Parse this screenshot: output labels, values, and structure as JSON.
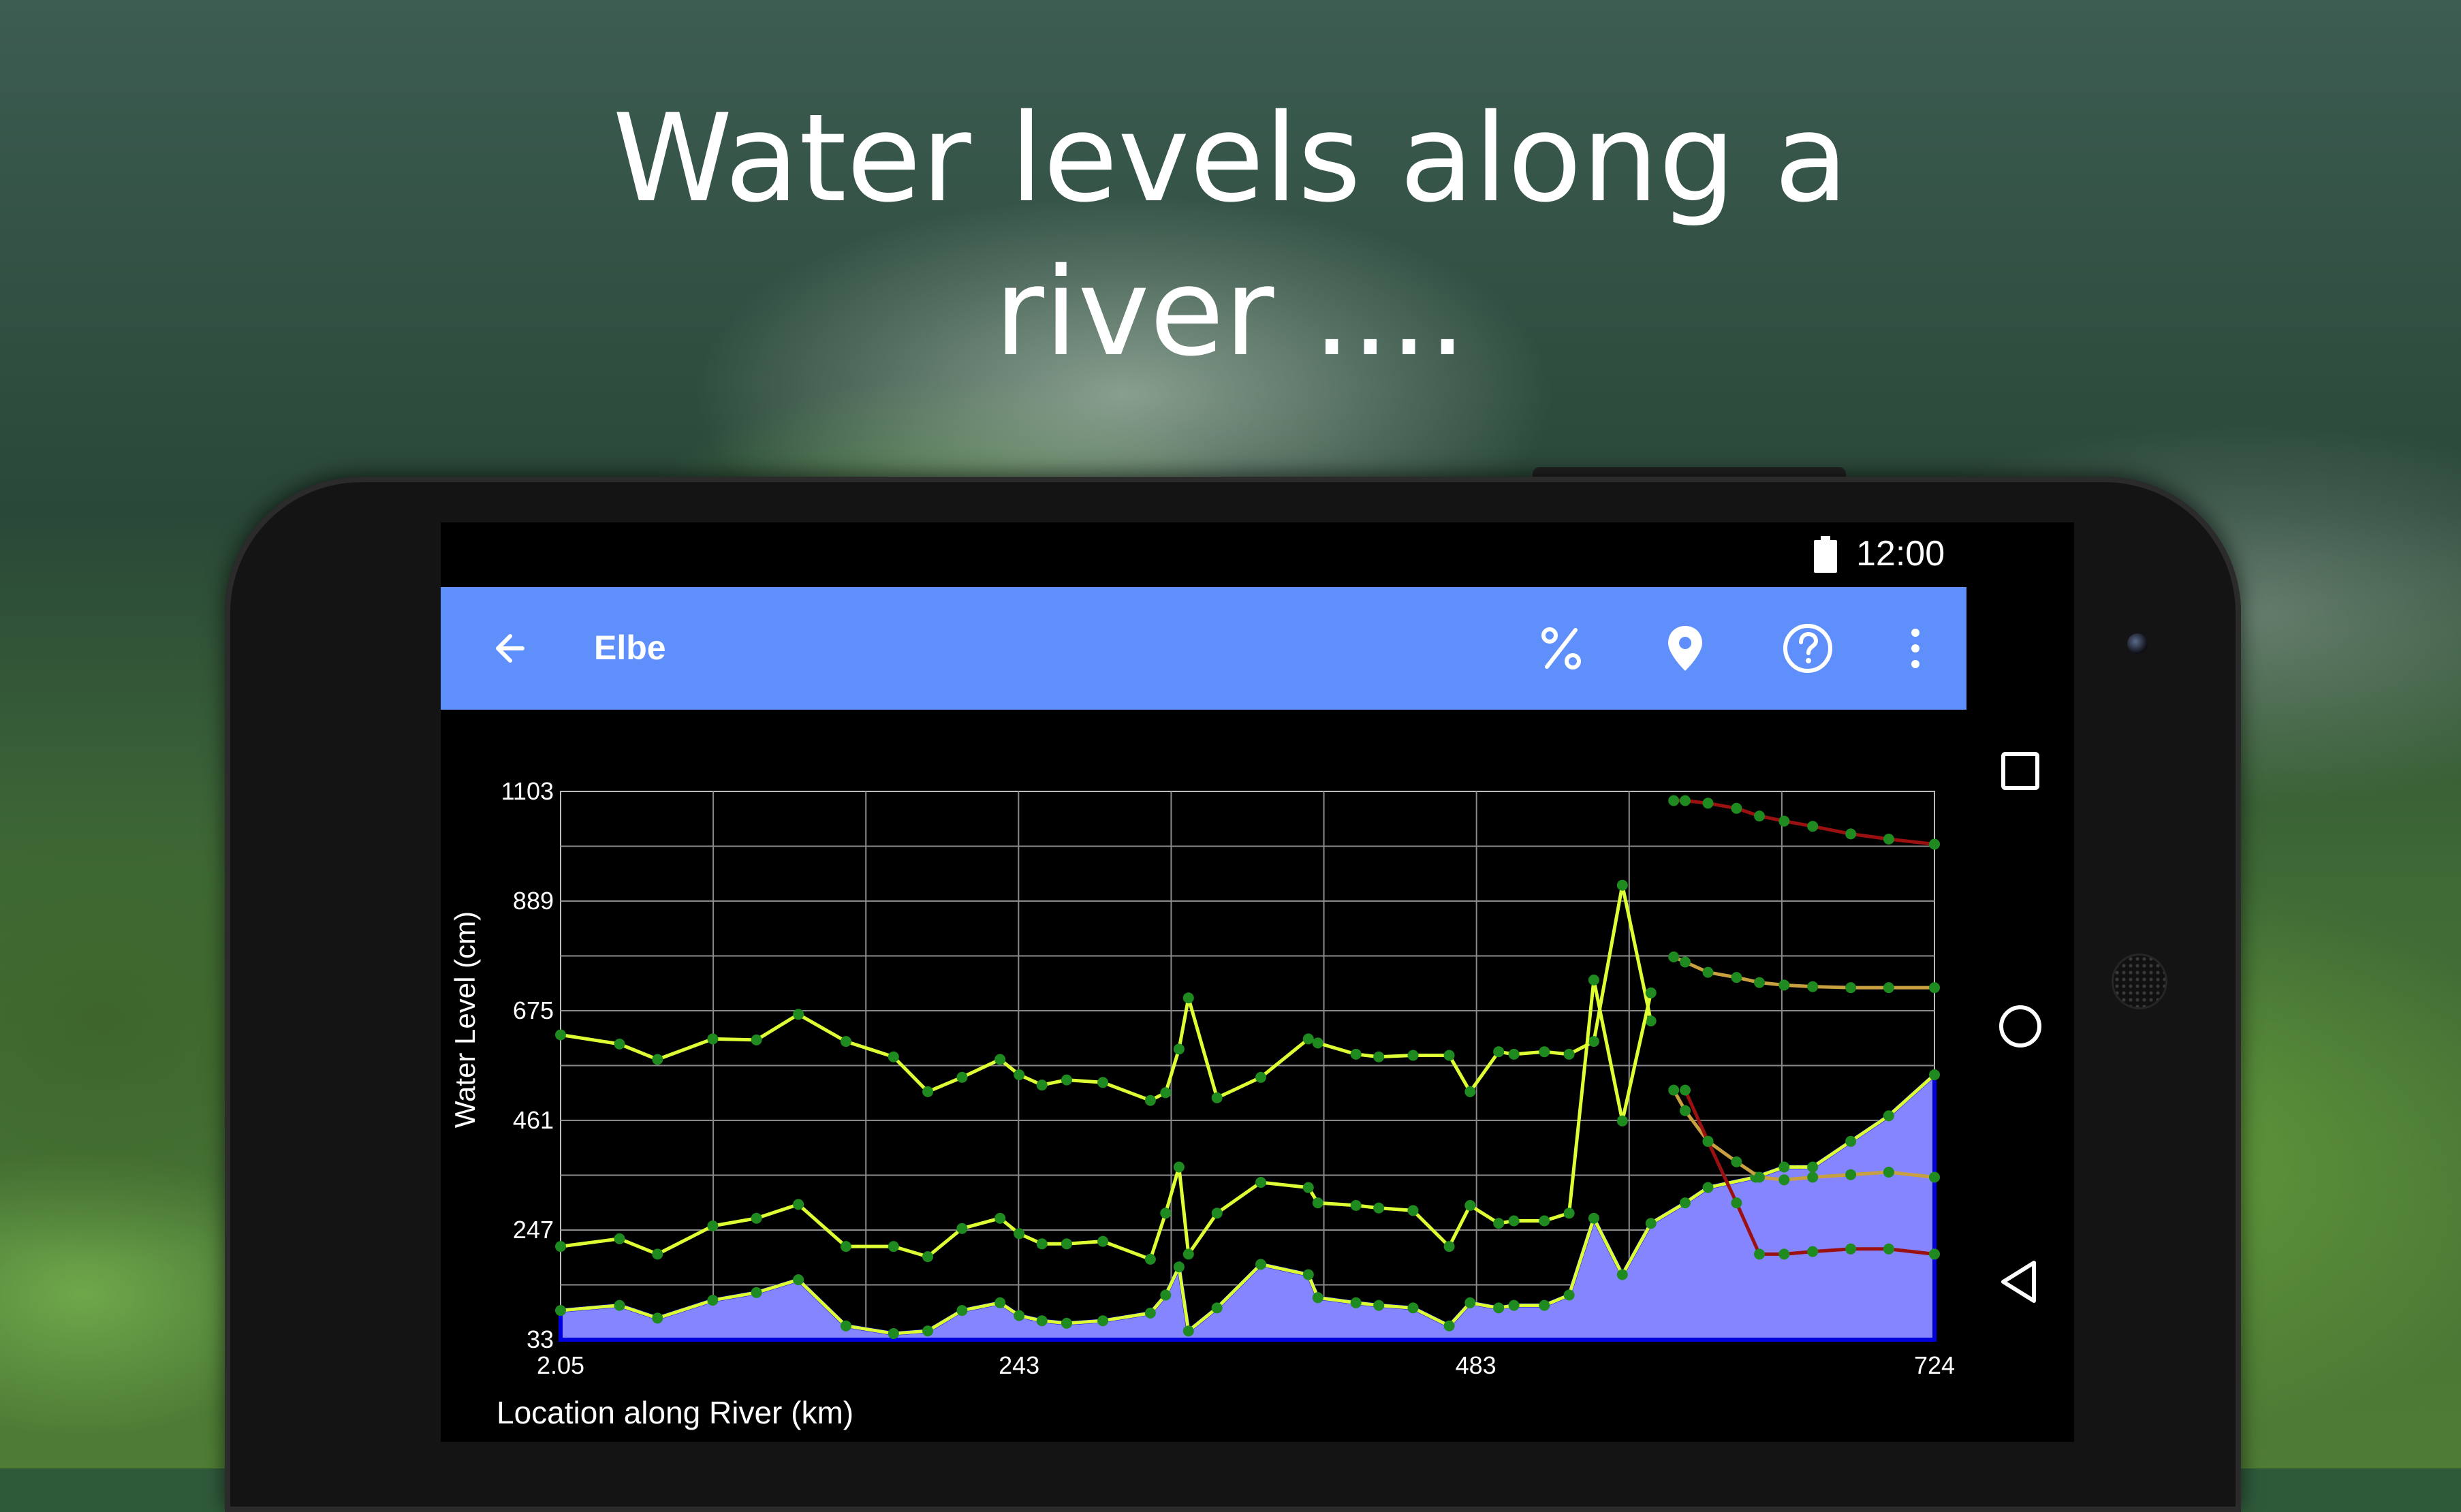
{
  "headline": {
    "line1": "Water levels along a",
    "line2": "river ...."
  },
  "status_bar": {
    "time": "12:00",
    "battery_icon": "battery-full-icon"
  },
  "app_bar": {
    "title": "Elbe",
    "background_color": "#5f8ffa",
    "back_icon": "arrow-left-icon",
    "actions": [
      {
        "name": "percent-button",
        "icon": "percent-icon"
      },
      {
        "name": "location-button",
        "icon": "map-pin-icon"
      },
      {
        "name": "help-button",
        "icon": "help-circle-icon"
      },
      {
        "name": "overflow-menu-button",
        "icon": "more-vertical-icon"
      }
    ]
  },
  "nav_bar": {
    "icons": [
      "recent-apps-icon",
      "home-icon",
      "back-triangle-icon"
    ]
  },
  "chart_data": {
    "type": "line",
    "xlabel": "Location along River (km)",
    "ylabel": "Water Level (cm)",
    "xlim": [
      2.05,
      724
    ],
    "ylim": [
      33,
      1103
    ],
    "x_ticks": [
      "2.05",
      "243",
      "483",
      "724"
    ],
    "y_ticks": [
      "1103",
      "889",
      "675",
      "461",
      "247",
      "33"
    ],
    "grid": true,
    "colors": {
      "filled_area": "#8585ff",
      "filled_area_edge": "#0000dd",
      "upper_band": "#ddff33",
      "flood_marks_red": "#9b1010",
      "flood_marks_tan": "#c8a040",
      "points": "#1f8a1f"
    },
    "series": [
      {
        "style": "line",
        "x": [
          2.05,
          33,
          53,
          82,
          105,
          127,
          152,
          177,
          195,
          213,
          233,
          243,
          255,
          268,
          287,
          312,
          320,
          327,
          332,
          347,
          370,
          395,
          400,
          420,
          432,
          450,
          469,
          480,
          495,
          503,
          519,
          532,
          545,
          560,
          575
        ],
        "y": [
          628,
          610,
          580,
          620,
          618,
          668,
          615,
          585,
          517,
          545,
          580,
          550,
          530,
          540,
          535,
          500,
          515,
          600,
          700,
          505,
          545,
          620,
          612,
          590,
          585,
          588,
          588,
          517,
          595,
          590,
          595,
          590,
          615,
          920,
          655
        ]
      },
      {
        "style": "line",
        "x": [
          2.05,
          33,
          53,
          82,
          105,
          127,
          152,
          177,
          195,
          213,
          233,
          243,
          255,
          268,
          287,
          312,
          320,
          327,
          332,
          347,
          370,
          395,
          400,
          420,
          432,
          450,
          469,
          480,
          495,
          503,
          519,
          532,
          545,
          560,
          575
        ],
        "y": [
          215,
          230,
          200,
          255,
          270,
          297,
          215,
          215,
          195,
          250,
          270,
          240,
          220,
          220,
          225,
          190,
          280,
          370,
          200,
          280,
          340,
          330,
          300,
          295,
          290,
          285,
          215,
          295,
          260,
          265,
          265,
          280,
          735,
          460,
          710
        ]
      },
      {
        "style": "area",
        "x": [
          2.05,
          33,
          53,
          82,
          105,
          127,
          152,
          177,
          195,
          213,
          233,
          243,
          255,
          268,
          287,
          312,
          320,
          327,
          332,
          347,
          370,
          395,
          400,
          420,
          432,
          450,
          469,
          480,
          495,
          503,
          519,
          532,
          545,
          560,
          575,
          593,
          605,
          630,
          645,
          660,
          680,
          700,
          724
        ],
        "y": [
          90,
          100,
          75,
          110,
          125,
          150,
          60,
          45,
          50,
          90,
          105,
          80,
          70,
          65,
          70,
          85,
          120,
          175,
          50,
          95,
          180,
          160,
          115,
          105,
          100,
          95,
          60,
          105,
          95,
          100,
          100,
          120,
          270,
          160,
          260,
          300,
          330,
          350,
          370,
          370,
          420,
          470,
          550
        ]
      },
      {
        "style": "line",
        "x": [
          587,
          593,
          605,
          620,
          632,
          645,
          660,
          680,
          700,
          724
        ],
        "y": [
          1085,
          1085,
          1080,
          1070,
          1055,
          1045,
          1035,
          1020,
          1010,
          1000
        ]
      },
      {
        "style": "line",
        "x": [
          587,
          593,
          605,
          620,
          632,
          645,
          660,
          680,
          700,
          724
        ],
        "y": [
          780,
          770,
          750,
          740,
          730,
          725,
          722,
          720,
          720,
          720
        ]
      },
      {
        "style": "line",
        "x": [
          587,
          593,
          605,
          620,
          632,
          645,
          660,
          680,
          700,
          724
        ],
        "y": [
          520,
          480,
          420,
          380,
          350,
          345,
          350,
          355,
          360,
          350
        ]
      },
      {
        "style": "line",
        "x": [
          593,
          605,
          620,
          632,
          645,
          660,
          680,
          700,
          724
        ],
        "y": [
          520,
          420,
          300,
          200,
          200,
          205,
          210,
          210,
          200
        ]
      }
    ]
  }
}
